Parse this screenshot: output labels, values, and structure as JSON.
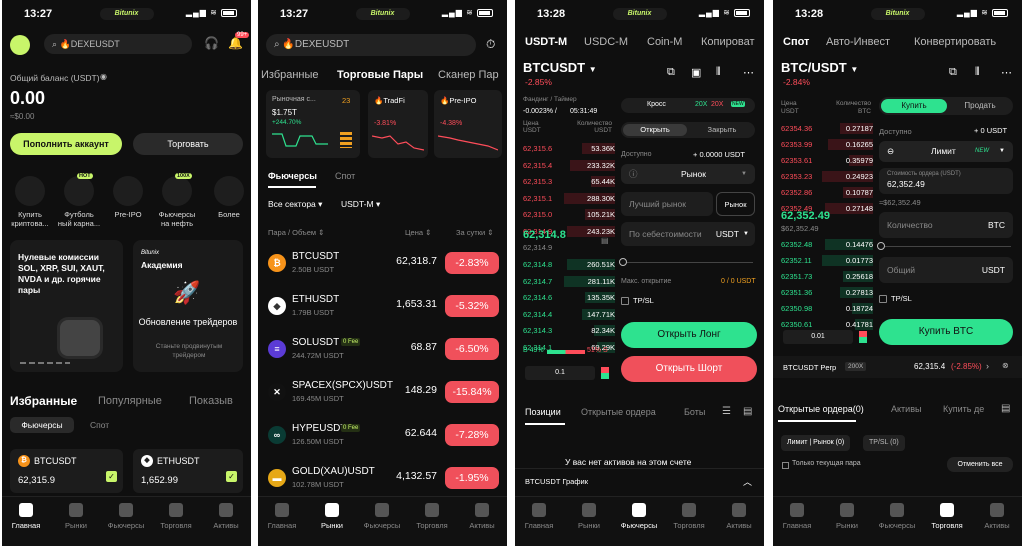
{
  "status": {
    "p1_time": "13:27",
    "p2_time": "13:27",
    "p3_time": "13:28",
    "p4_time": "13:28",
    "app_pill": "Bitunix",
    "badge": "99+"
  },
  "colors": {
    "accent": "#c8f56a",
    "green": "#2ee28f",
    "red": "#ff4d5a",
    "bg": "#0f0f0f"
  },
  "home": {
    "search_placeholder": "🔥DEXEUSDT",
    "balance_label": "Общий баланс (USDT)",
    "balance": "0.00",
    "balance_usd": "≈$0.00",
    "deposit_btn": "Пополнить аккаунт",
    "trade_btn": "Торговать",
    "shortcuts": [
      {
        "label": "Купить",
        "label2": "криптова...",
        "icon": "card-icon",
        "badge": ""
      },
      {
        "label": "Футболь",
        "label2": "ный карна...",
        "icon": "trophy-icon",
        "badge": "HOT"
      },
      {
        "label": "Pre-IPO",
        "label2": "",
        "icon": "ipo-icon",
        "badge": ""
      },
      {
        "label": "Фьючерсы",
        "label2": "на нефть",
        "icon": "oil-icon",
        "badge": "100X"
      },
      {
        "label": "Более",
        "label2": "",
        "icon": "grid-icon",
        "badge": ""
      }
    ],
    "promo1": {
      "title": "Нулевые комиссии SOL, XRP, SUI, XAUT, NVDA и др. горячие пары"
    },
    "promo2": {
      "brand": "Bitunix",
      "title": "Академия",
      "subtitle": "Обновление трейдеров",
      "desc": "Станьте продвинутым трейдером"
    },
    "tabs": [
      "Избранные",
      "Популярные",
      "Показыв"
    ],
    "subtabs": [
      "Фьючерсы",
      "Спот"
    ],
    "fav": [
      {
        "name": "BTCUSDT",
        "price": "62,315.9"
      },
      {
        "name": "ETHUSDT",
        "price": "1,652.99"
      }
    ]
  },
  "markets": {
    "search_placeholder": "🔥DEXEUSDT",
    "tabs": [
      "Избранные",
      "Торговые Пары",
      "Сканер Пар"
    ],
    "cards": [
      {
        "title": "Рыночная с...",
        "value": "$1.75T",
        "change": "+244.70%",
        "extra": "23"
      },
      {
        "title": "🔥TradFi",
        "change": "-3.81%"
      },
      {
        "title": "🔥Pre-IPO",
        "change": "-4.38%"
      }
    ],
    "subtabs": [
      "Фьючерсы",
      "Спот"
    ],
    "filter1": "Все сектора ▾",
    "filter2": "USDT-M ▾",
    "head": [
      "Пара / Объем ⇕",
      "Цена ⇕",
      "За сутки ⇕"
    ],
    "rows": [
      {
        "pair": "BTCUSDT",
        "vol": "2.50B USDT",
        "price": "62,318.7",
        "chg": "-2.83%",
        "fee": "",
        "icon": "₿",
        "bg": "#f7931a"
      },
      {
        "pair": "ETHUSDT",
        "vol": "1.79B USDT",
        "price": "1,653.31",
        "chg": "-5.32%",
        "fee": "",
        "icon": "◆",
        "bg": "#ffffff"
      },
      {
        "pair": "SOLUSDT",
        "vol": "244.72M USDT",
        "price": "68.87",
        "chg": "-6.50%",
        "fee": "0 Fee",
        "icon": "≡",
        "bg": "#5b3bd6"
      },
      {
        "pair": "SPACEX(SPCX)USDT",
        "vol": "169.45M USDT",
        "price": "148.29",
        "chg": "-15.84%",
        "fee": "",
        "icon": "✕",
        "bg": "#111111"
      },
      {
        "pair": "HYPEUSDT",
        "vol": "126.50M USDT",
        "price": "62.644",
        "chg": "-7.28%",
        "fee": "0 Fee",
        "icon": "∞",
        "bg": "#0a3b34"
      },
      {
        "pair": "GOLD(XAU)USDT",
        "vol": "102.78M USDT",
        "price": "4,132.57",
        "chg": "-1.95%",
        "fee": "",
        "icon": "▬",
        "bg": "#e6a817"
      }
    ]
  },
  "futures": {
    "tabs": [
      "USDT-M",
      "USDC-M",
      "Coin-M",
      "Копироват"
    ],
    "pair": "BTCUSDT",
    "change": "-2.85%",
    "funding_label": "Фандинг / Таймер",
    "funding": "-0.0023% /",
    "timer": "05:31:49",
    "ob_head_price": "Цена USDT",
    "ob_head_qty": "Количество USDT",
    "asks": [
      [
        "62,315.6",
        "53.36K"
      ],
      [
        "62,315.4",
        "233.32K"
      ],
      [
        "62,315.3",
        "65.44K"
      ],
      [
        "62,315.1",
        "288.30K"
      ],
      [
        "62,315.0",
        "105.21K"
      ],
      [
        "62,314.9",
        "243.23K"
      ]
    ],
    "mid": "62,314.8",
    "mid_sub": "62,314.9",
    "bids": [
      [
        "62,314.8",
        "260.51K"
      ],
      [
        "62,314.7",
        "281.11K"
      ],
      [
        "62,314.6",
        "135.35K"
      ],
      [
        "62,314.4",
        "147.71K"
      ],
      [
        "62,314.3",
        "82.34K"
      ],
      [
        "62,314.1",
        "69.29K"
      ]
    ],
    "ratio_b": "B 49%",
    "ratio_s": "51% S",
    "step": "0.1",
    "mode": "Кросс",
    "lev1": "20X",
    "lev2": "20X",
    "new": "NEW",
    "open": "Открыть",
    "close": "Закрыть",
    "avail_label": "Доступно",
    "avail": "0.0000 USDT",
    "order_type": "Рынок",
    "price_placeholder": "Лучший рынок",
    "price_btn": "Рынок",
    "cost_label": "По себестоимости",
    "cost_unit": "USDT",
    "max_label": "Макс. открытие",
    "max_val": "0 / 0 USDT",
    "tpsl": "TP/SL",
    "long": "Открыть Лонг",
    "short": "Открыть Шорт",
    "bottom_tabs": [
      "Позиции",
      "Открытые ордера",
      "Боты"
    ],
    "empty": "У вас нет активов на этом счете",
    "chart_label": "BTCUSDT График"
  },
  "spot": {
    "tabs": [
      "Спот",
      "Авто-Инвест",
      "Конвертировать"
    ],
    "pair": "BTC/USDT",
    "change": "-2.84%",
    "head_price": "Цена USDT",
    "head_qty": "Количество BTC",
    "asks": [
      [
        "62354.36",
        "0.27187"
      ],
      [
        "62353.99",
        "0.16265"
      ],
      [
        "62353.61",
        "0.35979"
      ],
      [
        "62353.23",
        "0.24923"
      ],
      [
        "62352.86",
        "0.10787"
      ],
      [
        "62352.49",
        "0.27148"
      ]
    ],
    "mid": "62,352.49",
    "mid_sub": "$62,352.49",
    "bids": [
      [
        "62352.48",
        "0.14476"
      ],
      [
        "62352.11",
        "0.01773"
      ],
      [
        "62351.73",
        "0.25618"
      ],
      [
        "62351.36",
        "0.27813"
      ],
      [
        "62350.98",
        "0.18724"
      ],
      [
        "62350.61",
        "0.41781"
      ]
    ],
    "step": "0.01",
    "buy": "Купить",
    "sell": "Продать",
    "avail_label": "Доступно",
    "avail": "0 USDT",
    "order_type": "Лимит",
    "price_label": "Стоимость ордера (USDT)",
    "price": "62,352.49",
    "price_usd": "≈$62,352.49",
    "qty": "Количество",
    "qty_unit": "BTC",
    "total": "Общий",
    "total_unit": "USDT",
    "tpsl": "TP/SL",
    "buy_btn": "Купить BTC",
    "perp": "BTCUSDT Perp",
    "perp_lev": "200X",
    "perp_price": "62,315.4",
    "perp_chg": "(-2.85%)",
    "bottom_tabs": [
      "Открытые ордера(0)",
      "Активы",
      "Купить де"
    ],
    "filter1": "Лимит | Рынок (0)",
    "filter2": "TP/SL (0)",
    "only_pair": "Только текущая пара",
    "cancel_all": "Отменить все"
  },
  "nav": [
    "Главная",
    "Рынки",
    "Фьючерсы",
    "Торговля",
    "Активы"
  ]
}
